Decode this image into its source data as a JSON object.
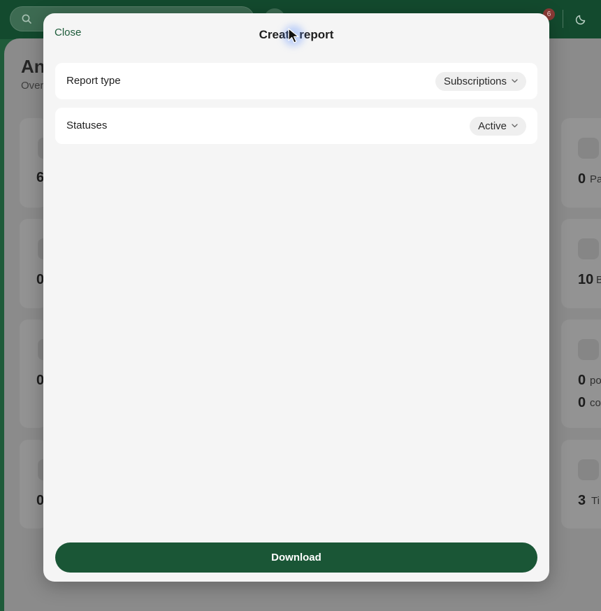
{
  "topbar": {
    "notification_count": "6",
    "icons": {
      "search": "search-icon",
      "theme": "moon-icon"
    }
  },
  "background_page": {
    "title": "An",
    "subtitle": "Over"
  },
  "left_cards": [
    {
      "number": "6"
    },
    {
      "number": "0"
    },
    {
      "number": "0"
    },
    {
      "number": "0"
    }
  ],
  "right_cards": [
    {
      "icon": "dollar-icon",
      "lines": [
        {
          "number": "0",
          "label": "Pa"
        }
      ]
    },
    {
      "icon": "monitor-icon",
      "lines": [
        {
          "number": "10",
          "label": "B"
        }
      ]
    },
    {
      "icon": "rss-icon",
      "lines": [
        {
          "number": "0",
          "label": "po"
        },
        {
          "number": "0",
          "label": "co"
        }
      ]
    },
    {
      "icon": "ticket-icon",
      "lines": [
        {
          "number": "3",
          "label": "Ti"
        }
      ]
    }
  ],
  "modal": {
    "close_label": "Close",
    "title": "Create report",
    "rows": [
      {
        "label": "Report type",
        "value": "Subscriptions"
      },
      {
        "label": "Statuses",
        "value": "Active"
      }
    ],
    "download_label": "Download"
  },
  "colors": {
    "accent": "#1a5636",
    "topbar": "#134a2e",
    "modal_bg": "#f5f5f5",
    "badge": "#8a3a36"
  }
}
